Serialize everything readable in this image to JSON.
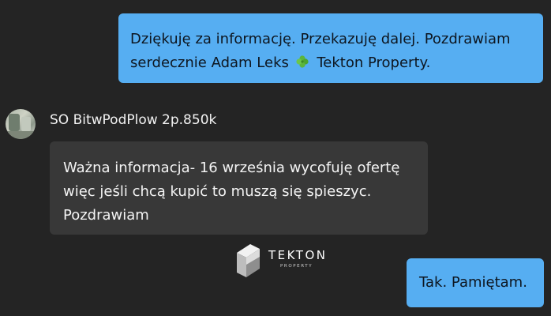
{
  "messages": {
    "outgoing_1": {
      "line1": "Dziękuję za informację. Przekazuję dalej. Pozdrawiam",
      "line2a": "serdecznie Adam Leks",
      "line2b": "Tekton Property."
    },
    "incoming_1": {
      "sender": "SO BitwPodPlow 2p.850k",
      "line1": "Ważna informacja- 16 września wycofuję ofertę",
      "line2": "więc jeśli chcą kupić to muszą się spieszyc.",
      "line3": "Pozdrawiam"
    },
    "outgoing_2": {
      "text": "Tak. Pamiętam."
    }
  },
  "logo": {
    "name": "TEKTON",
    "sub": "PROPERTY"
  },
  "icons": {
    "emoji": "four-leaf-clover-icon",
    "logo": "tekton-cube-icon"
  },
  "colors": {
    "background": "#242424",
    "outgoing_bubble": "#56aef2",
    "incoming_bubble": "#383838"
  }
}
